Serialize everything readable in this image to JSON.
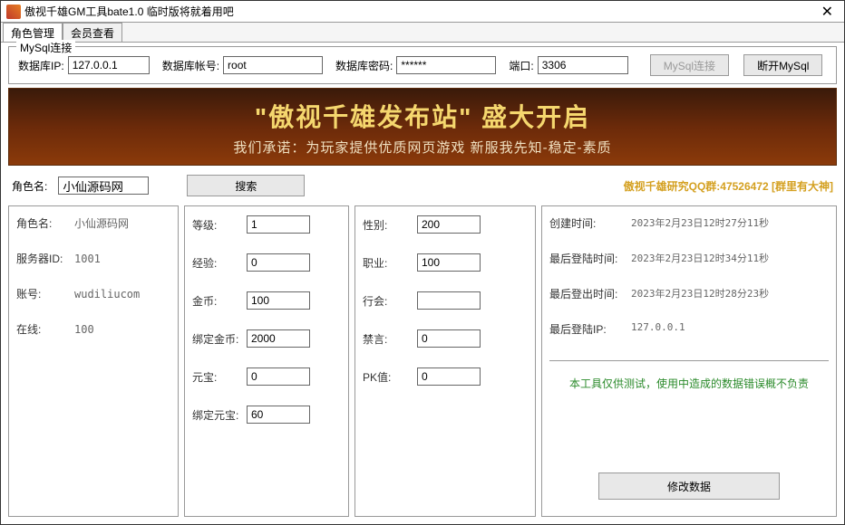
{
  "window": {
    "title": "傲视千雄GM工具bate1.0 临时版将就着用吧"
  },
  "tabs": {
    "role_mgmt": "角色管理",
    "member_view": "会员查看"
  },
  "mysql": {
    "legend": "MySql连接",
    "ip_label": "数据库IP:",
    "ip_value": "127.0.0.1",
    "user_label": "数据库帐号:",
    "user_value": "root",
    "pass_label": "数据库密码:",
    "pass_value": "******",
    "port_label": "端口:",
    "port_value": "3306",
    "connect_btn": "MySql连接",
    "disconnect_btn": "断开MySql"
  },
  "banner": {
    "main": "\"傲视千雄发布站\" 盛大开启",
    "sub": "我们承诺：为玩家提供优质网页游戏 新服我先知-稳定-素质"
  },
  "search": {
    "label": "角色名:",
    "value": "小仙源码网",
    "btn": "搜索",
    "qq": "傲视千雄研究QQ群:47526472  [群里有大神]"
  },
  "info": {
    "role_label": "角色名:",
    "role_value": "小仙源码网",
    "server_label": "服务器ID:",
    "server_value": "1001",
    "account_label": "账号:",
    "account_value": "wudiliucom",
    "online_label": "在线:",
    "online_value": "100"
  },
  "edit1": {
    "level_label": "等级:",
    "level_value": "1",
    "exp_label": "经验:",
    "exp_value": "0",
    "gold_label": "金币:",
    "gold_value": "100",
    "bind_gold_label": "绑定金币:",
    "bind_gold_value": "2000",
    "yuanbao_label": "元宝:",
    "yuanbao_value": "0",
    "bind_yuanbao_label": "绑定元宝:",
    "bind_yuanbao_value": "60"
  },
  "edit2": {
    "sex_label": "性别:",
    "sex_value": "200",
    "job_label": "职业:",
    "job_value": "100",
    "guild_label": "行会:",
    "guild_value": "",
    "mute_label": "禁言:",
    "mute_value": "0",
    "pk_label": "PK值:",
    "pk_value": "0"
  },
  "times": {
    "create_label": "创建时间:",
    "create_value": "2023年2月23日12时27分11秒",
    "last_login_label": "最后登陆时间:",
    "last_login_value": "2023年2月23日12时34分11秒",
    "last_logout_label": "最后登出时间:",
    "last_logout_value": "2023年2月23日12时28分23秒",
    "last_ip_label": "最后登陆IP:",
    "last_ip_value": "127.0.0.1"
  },
  "disclaimer": "本工具仅供测试，使用中造成的数据错误概不负责",
  "modify_btn": "修改数据"
}
